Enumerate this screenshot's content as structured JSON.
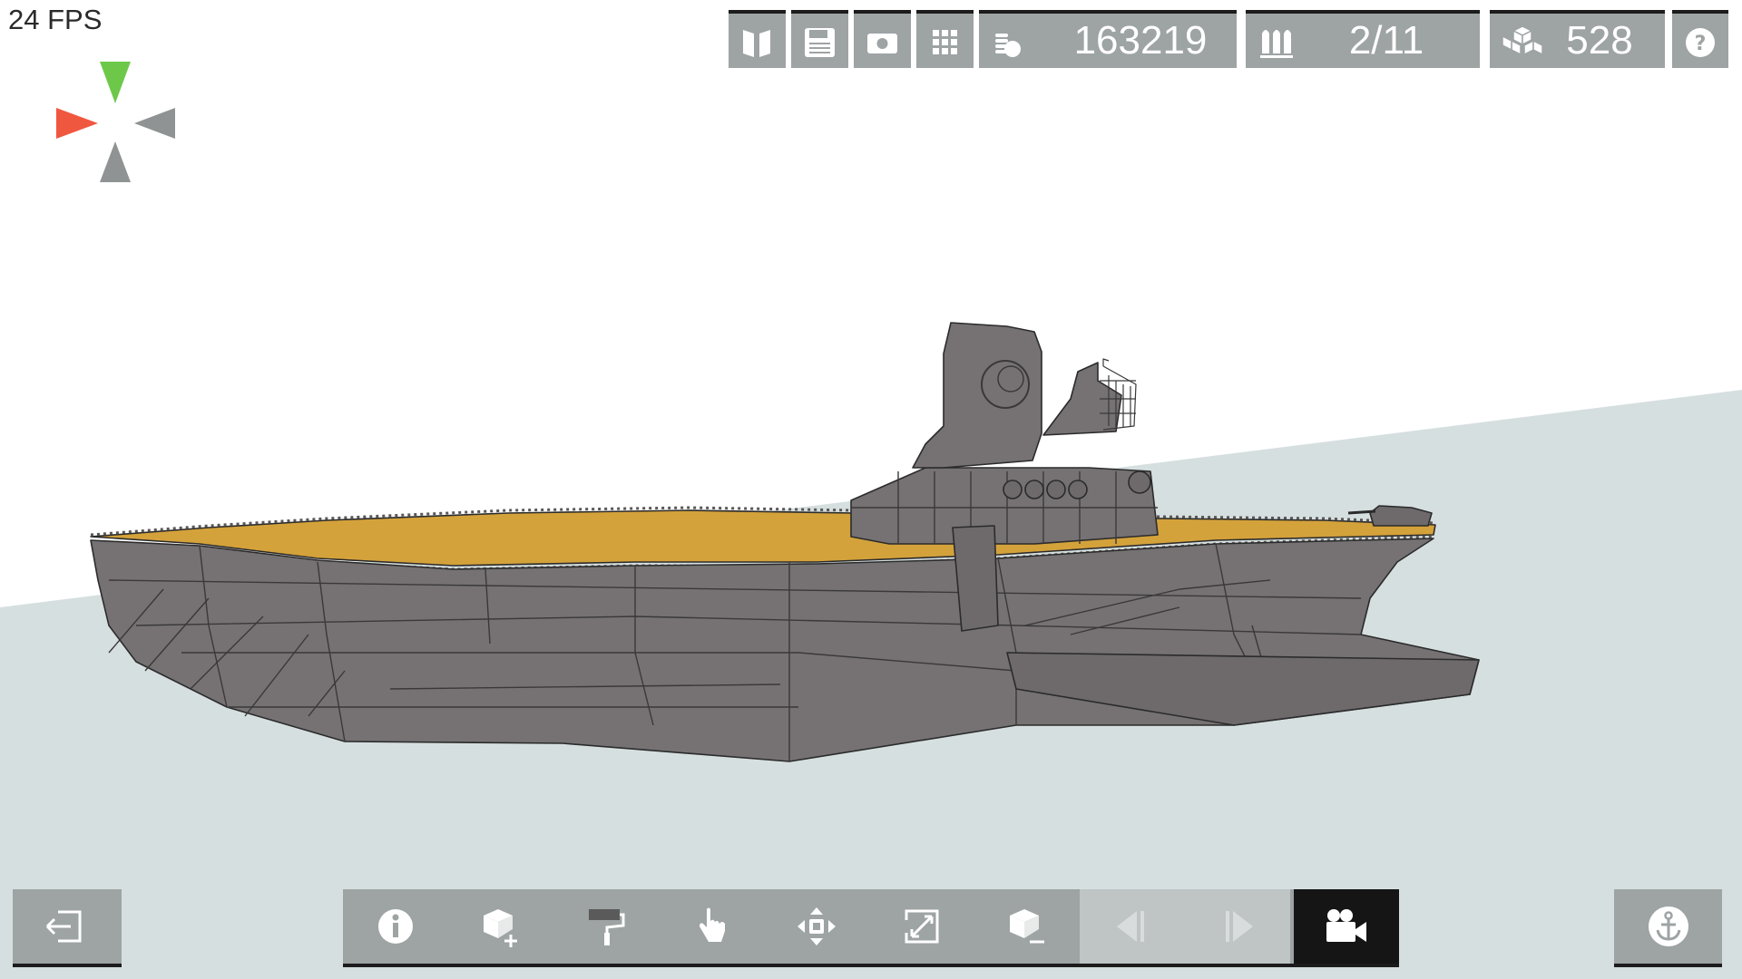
{
  "hud": {
    "fps_label": "24 FPS"
  },
  "compass": {
    "up_color": "#6dc84a",
    "left_color": "#f0573f",
    "neutral_color": "#8f9394"
  },
  "top_bar": {
    "buttons": [
      {
        "name": "catalog-button",
        "icon": "book-icon"
      },
      {
        "name": "save-button",
        "icon": "floppy-disk-icon"
      },
      {
        "name": "screenshot-button",
        "icon": "camera-icon"
      },
      {
        "name": "grid-button",
        "icon": "grid-icon"
      }
    ],
    "cost": {
      "icon": "coins-icon",
      "value": "163219"
    },
    "ammo": {
      "icon": "shells-icon",
      "value": "2/11"
    },
    "blocks": {
      "icon": "cubes-icon",
      "value": "528"
    },
    "help": {
      "icon": "question-icon"
    }
  },
  "bottom_bar": {
    "exit": {
      "icon": "exit-icon"
    },
    "tools": [
      {
        "name": "info-tool",
        "icon": "info-icon",
        "state": "normal"
      },
      {
        "name": "add-block-tool",
        "icon": "add-block-icon",
        "state": "normal"
      },
      {
        "name": "paint-tool",
        "icon": "paint-roller-icon",
        "state": "normal"
      },
      {
        "name": "select-tool",
        "icon": "hand-pointer-icon",
        "state": "normal"
      },
      {
        "name": "move-tool",
        "icon": "move-arrows-icon",
        "state": "normal"
      },
      {
        "name": "scale-tool",
        "icon": "resize-icon",
        "state": "normal"
      },
      {
        "name": "remove-block-tool",
        "icon": "remove-block-icon",
        "state": "normal"
      },
      {
        "name": "undo-tool",
        "icon": "step-back-icon",
        "state": "disabled"
      },
      {
        "name": "redo-tool",
        "icon": "step-forward-icon",
        "state": "disabled"
      },
      {
        "name": "camera-tool",
        "icon": "video-camera-icon",
        "state": "active"
      }
    ],
    "anchor": {
      "icon": "anchor-icon"
    }
  },
  "colors": {
    "toolbar": "#9ea3a4",
    "toolbar_disabled": "#bfc4c5",
    "toolbar_active": "#151515",
    "hull": "#767273",
    "deck": "#d4a23b",
    "water": "#d6dfdf",
    "sky": "#ffffff"
  }
}
